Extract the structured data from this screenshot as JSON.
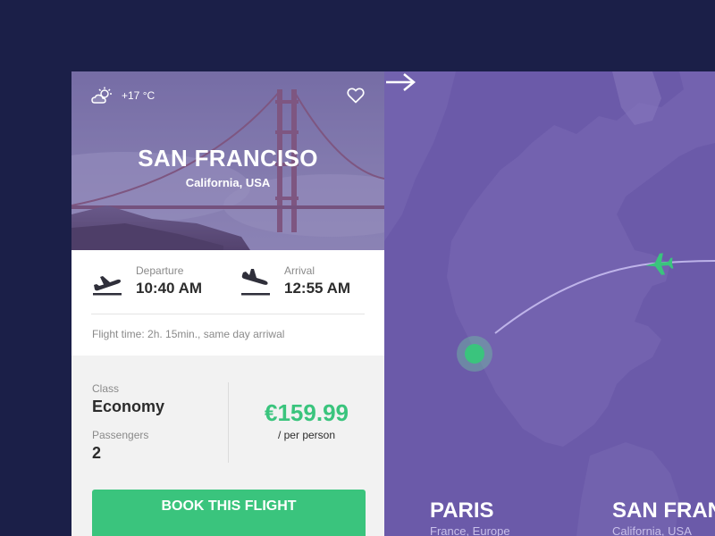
{
  "hero": {
    "temperature": "+17 °C",
    "city": "SAN FRANCISO",
    "region": "California, USA",
    "weather_icon": "partly-cloudy-icon",
    "favorite_icon": "heart-icon"
  },
  "flight": {
    "departure_label": "Departure",
    "departure_time": "10:40 AM",
    "arrival_label": "Arrival",
    "arrival_time": "12:55 AM",
    "flight_time": "Flight time: 2h. 15min., same day arriwal"
  },
  "booking": {
    "class_label": "Class",
    "class_value": "Economy",
    "passengers_label": "Passengers",
    "passengers_value": "2",
    "price": "€159.99",
    "price_note": "/ per person",
    "book_label": "BOOK THIS FLIGHT"
  },
  "route": {
    "from_city": "PARIS",
    "from_region": "France, Europe",
    "to_city": "SAN FRANCISO",
    "to_region": "California, USA"
  },
  "colors": {
    "background": "#1b1f48",
    "accent": "#3ac47d",
    "map": "#6b5aa9"
  }
}
